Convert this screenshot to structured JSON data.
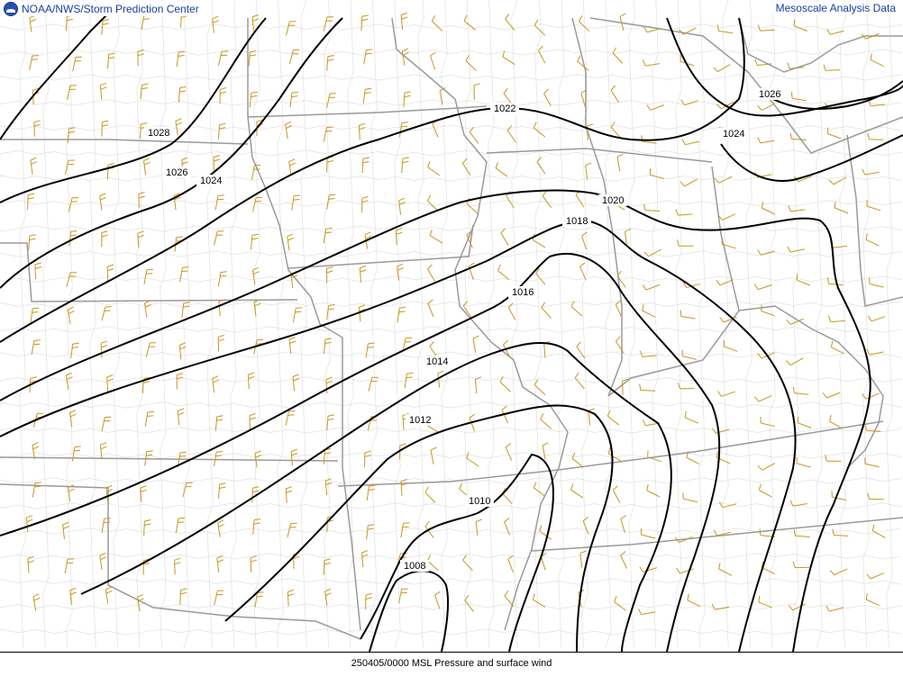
{
  "header": {
    "source": "NOAA/NWS/Storm Prediction Center",
    "product": "Mesoscale Analysis Data"
  },
  "footer": {
    "caption": "250405/0000 MSL Pressure and surface wind"
  },
  "map": {
    "isobars": [
      {
        "value": "1008",
        "label": "1008"
      },
      {
        "value": "1010",
        "label": "1010"
      },
      {
        "value": "1012",
        "label": "1012"
      },
      {
        "value": "1014",
        "label": "1014"
      },
      {
        "value": "1016",
        "label": "1016"
      },
      {
        "value": "1018",
        "label": "1018"
      },
      {
        "value": "1020",
        "label": "1020"
      },
      {
        "value": "1022",
        "label": "1022"
      },
      {
        "value": "1024",
        "label": "1024"
      },
      {
        "value": "1026",
        "label": "1026"
      },
      {
        "value": "1028",
        "label": "1028"
      }
    ],
    "colors": {
      "isobar": "#000000",
      "state_border": "#999999",
      "county_border": "#dcdcdc",
      "wind_barb": "#c8961e"
    }
  }
}
